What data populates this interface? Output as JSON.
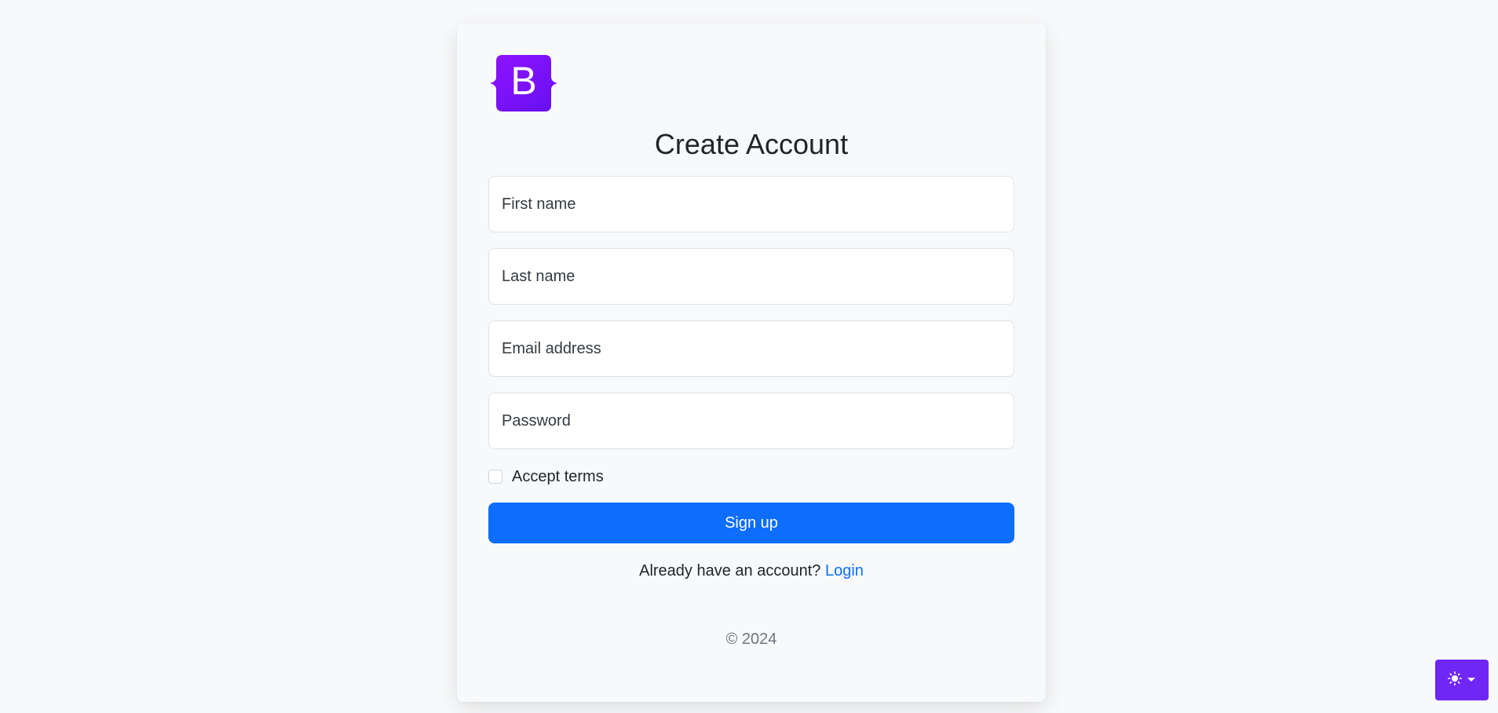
{
  "brand": {
    "logo_letter": "B",
    "logo_color": "#7b12f9"
  },
  "form": {
    "title": "Create Account",
    "first_name_placeholder": "First name",
    "last_name_placeholder": "Last name",
    "email_placeholder": "Email address",
    "password_placeholder": "Password",
    "accept_terms_label": "Accept terms",
    "accept_terms_checked": false,
    "signup_label": "Sign up",
    "login_prompt": "Already have an account?",
    "login_link": "Login"
  },
  "footer": {
    "copyright": "© 2024"
  },
  "theme_toggle": {
    "icon": "sun-icon",
    "caret": "chevron-down-icon",
    "color": "#7026f5"
  },
  "colors": {
    "primary": "#0d6efd",
    "background": "#f8f9fa"
  }
}
